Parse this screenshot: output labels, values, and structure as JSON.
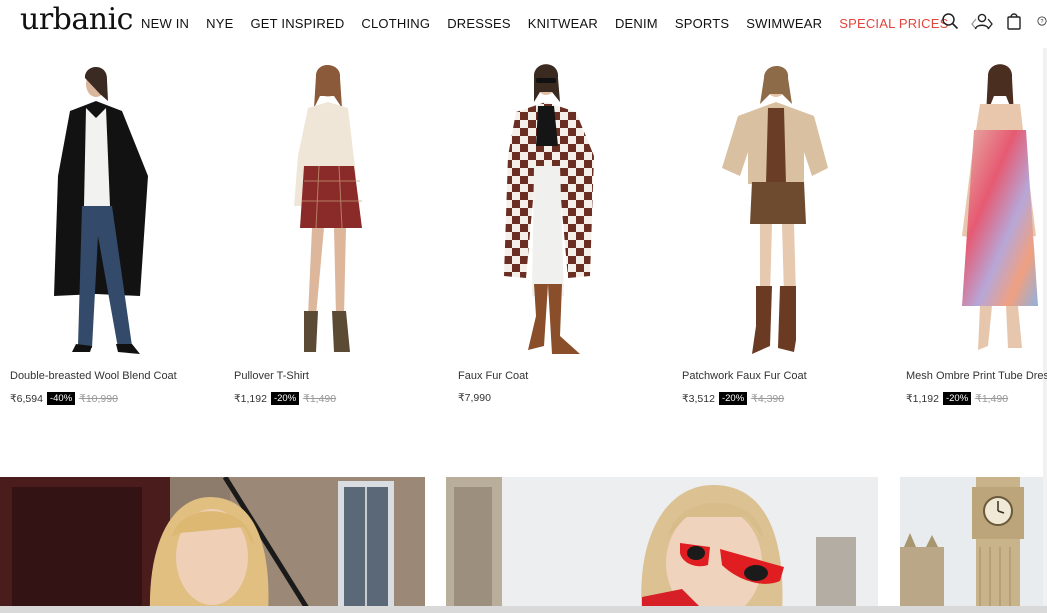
{
  "brand": {
    "logo_text": "urbanic"
  },
  "nav": {
    "items": [
      "NEW IN",
      "NYE",
      "GET INSPIRED",
      "CLOTHING",
      "DRESSES",
      "KNITWEAR",
      "DENIM",
      "SPORTS",
      "SWIMWEAR"
    ],
    "special": "SPECIAL PRICES",
    "special_color": "#e2453c"
  },
  "header_icons": [
    "search-icon",
    "user-icon",
    "bag-icon",
    "help-icon"
  ],
  "products": [
    {
      "name": "Double-breasted Wool Blend Coat",
      "price": "₹6,594",
      "discount": "-40%",
      "old_price": "₹10,990"
    },
    {
      "name": "Pullover T-Shirt",
      "price": "₹1,192",
      "discount": "-20%",
      "old_price": "₹1,490"
    },
    {
      "name": "Faux Fur Coat",
      "price": "₹7,990",
      "discount": "",
      "old_price": ""
    },
    {
      "name": "Patchwork Faux Fur Coat",
      "price": "₹3,512",
      "discount": "-20%",
      "old_price": "₹4,390"
    },
    {
      "name": "Mesh Ombre Print Tube Dress",
      "price": "₹1,192",
      "discount": "-20%",
      "old_price": "₹1,490"
    }
  ],
  "banners": [
    "banner-image-blonde-woman-london-window",
    "banner-image-woman-red-sunglasses",
    "banner-image-big-ben"
  ]
}
